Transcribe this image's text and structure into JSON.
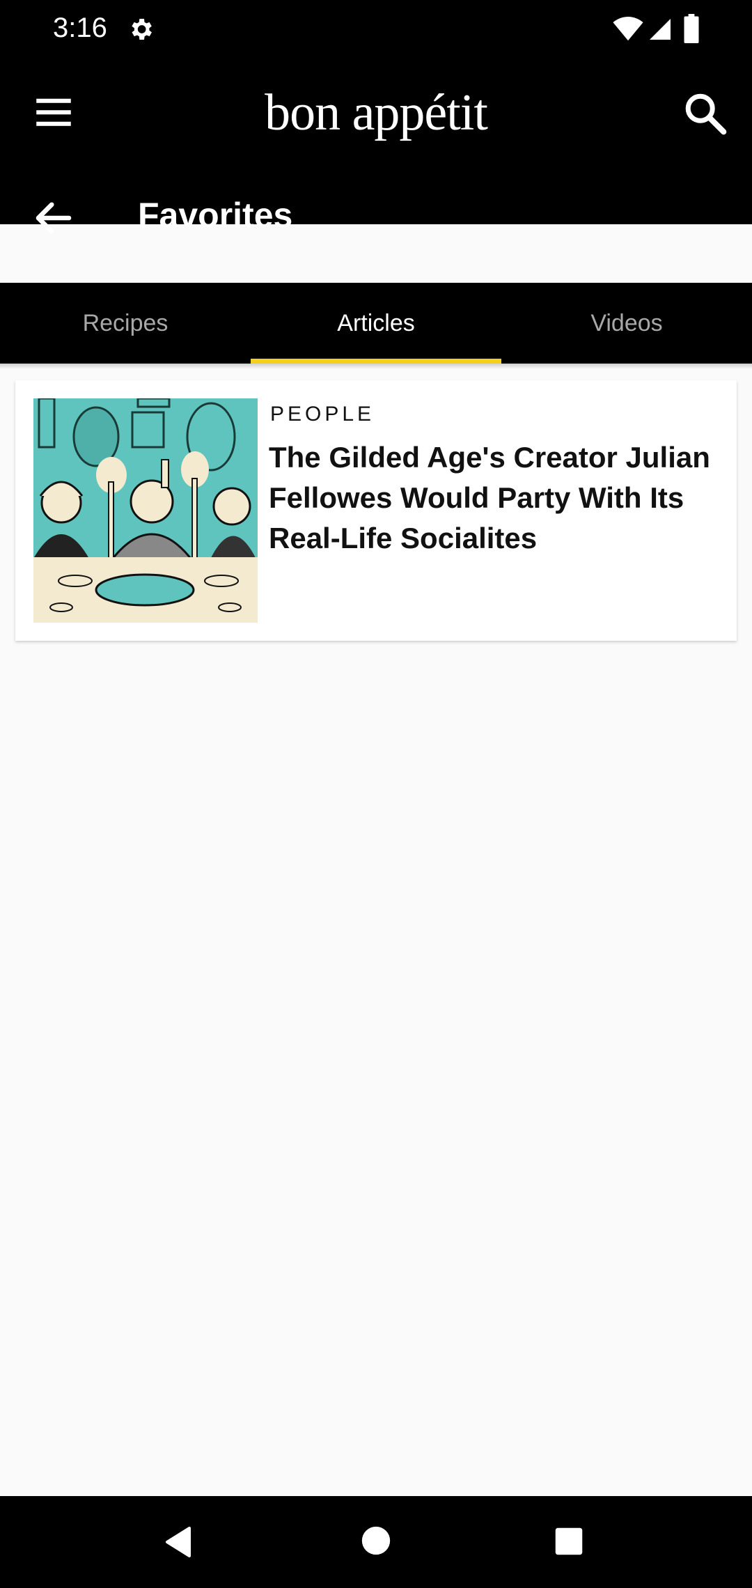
{
  "status_bar": {
    "time": "3:16"
  },
  "app_bar": {
    "brand": "bon appétit",
    "title": "Favorites"
  },
  "tabs": [
    {
      "label": "Recipes",
      "active": false
    },
    {
      "label": "Articles",
      "active": true
    },
    {
      "label": "Videos",
      "active": false
    }
  ],
  "articles": [
    {
      "category": "PEOPLE",
      "title": "The Gilded Age's Creator Julian Fellowes Would Party With Its Real-Life Socialites"
    }
  ],
  "colors": {
    "tab_indicator": "#f4d01a",
    "app_bar": "#000000",
    "background": "#fafafa"
  }
}
